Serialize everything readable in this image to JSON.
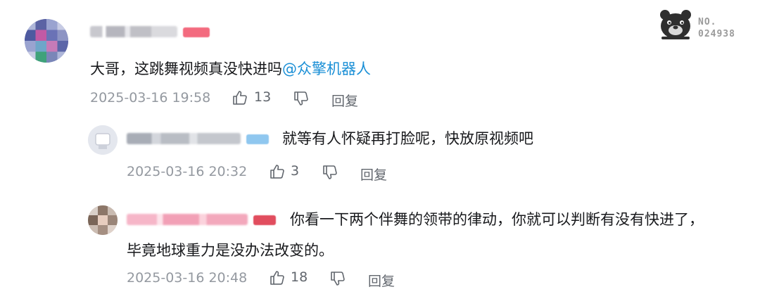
{
  "comment": {
    "text_plain": "大哥，这跳舞视频真没快进吗",
    "mention": "@众擎机器人",
    "time": "2025-03-16 19:58",
    "likes": "13",
    "reply_label": "回复"
  },
  "replies": [
    {
      "username_hint": "bili_",
      "text": "就等有人怀疑再打脸呢，快放原视频吧",
      "time": "2025-03-16 20:32",
      "likes": "3",
      "reply_label": "回复"
    },
    {
      "text_line1": "你看一下两个伴舞的领带的律动，你就可以判断有没有快进了，",
      "text_line2": "毕竟地球重力是没办法改变的。",
      "time": "2025-03-16 20:48",
      "likes": "18",
      "reply_label": "回复"
    }
  ],
  "watermark": {
    "label": "NO.",
    "number": "024938"
  },
  "colors": {
    "mention": "#1a8fd6",
    "meta": "#9499a0",
    "text": "#18191c"
  }
}
